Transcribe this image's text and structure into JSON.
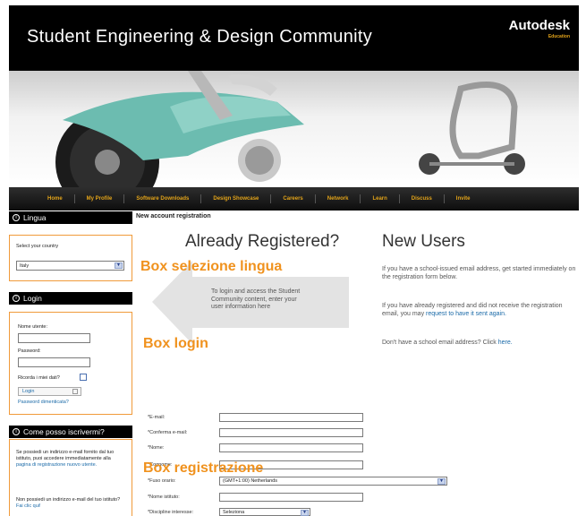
{
  "header": {
    "site_title": "Student Engineering & Design Community",
    "brand": "Autodesk",
    "brand_sub": "Education"
  },
  "nav": [
    "Home",
    "My Profile",
    "Software Downloads",
    "Design Showcase",
    "Careers",
    "Network",
    "Learn",
    "Discuss",
    "Invite"
  ],
  "sidebar": {
    "lingua": {
      "title": "Lingua",
      "select_label": "Select your country",
      "selected": "Italy"
    },
    "login": {
      "title": "Login",
      "username_label": "Nome utente:",
      "password_label": "Password:",
      "remember_label": "Ricorda i miei dati?",
      "login_button": "Login",
      "forgot_link": "Password dimenticata?"
    },
    "register": {
      "title": "Come posso iscrivermi?",
      "text1": "Se possiedi un indirizzo e-mail fornito dal tuo istituto, puoi accedere immediatamente alla",
      "link1": "pagina di registrazione nuovo utente.",
      "text2": "Non possiedi un indirizzo e-mail del tuo istituto?",
      "link2": "Fai clic qui!"
    }
  },
  "main": {
    "breadcrumb": "New account registration",
    "already_title": "Already Registered?",
    "already_text": "To login and access the Student Community content, enter your user information here",
    "new_title": "New Users",
    "new_p1": "If you have a school-issued email address, get started immediately on the registration form below.",
    "new_p2": "If you have already registered and did not receive the registration email, you may",
    "new_p2_link": "request to have it sent again.",
    "new_p3": "Don't have a school email address? Click",
    "new_p3_link": "here."
  },
  "form": {
    "email": "*E-mail:",
    "confirm_email": "*Conferma e-mail:",
    "first_name": "*Nome:",
    "last_name": "*Cognome:",
    "timezone_label": "*Fuso orario:",
    "timezone_value": "(GMT+1:00) Netherlands",
    "school_name": "*Nome istituto:",
    "discipline_label": "*Discipline interesse:",
    "discipline_value": "Seleziona"
  },
  "overlays": {
    "language_box": "Box selezione lingua",
    "login_box": "Box login",
    "register_box": "Box registrazione"
  },
  "colors": {
    "accent_orange": "#f0921e",
    "nav_text": "#e3a41a",
    "link_blue": "#1a6aa8"
  }
}
